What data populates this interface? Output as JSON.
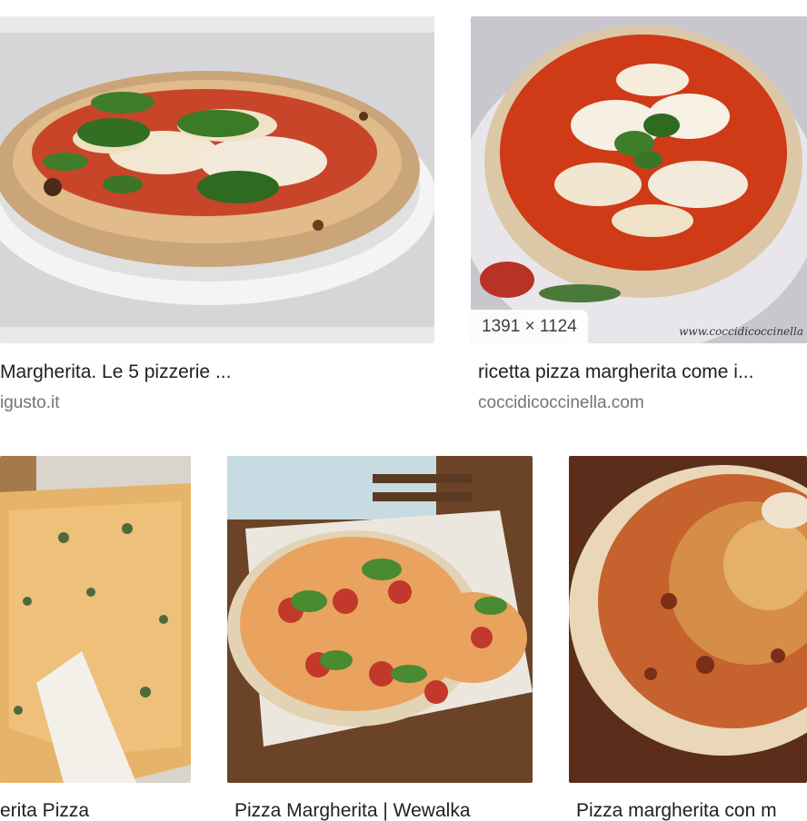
{
  "results": [
    {
      "title": "Margherita. Le 5 pizzerie ...",
      "source": "igusto.it",
      "image_icon": "pizza-margherita-image"
    },
    {
      "title": "ricetta pizza margherita come i...",
      "source": "coccidicoccinella.com",
      "dimensions": "1391 × 1124",
      "watermark": "www.coccidicoccinella",
      "image_icon": "pizza-margherita-image"
    },
    {
      "title": "erita Pizza",
      "image_icon": "pizza-slices-image"
    },
    {
      "title": "Pizza Margherita | Wewalka",
      "image_icon": "pizza-salami-image"
    },
    {
      "title": "Pizza margherita con m",
      "image_icon": "pizza-closeup-image"
    }
  ]
}
